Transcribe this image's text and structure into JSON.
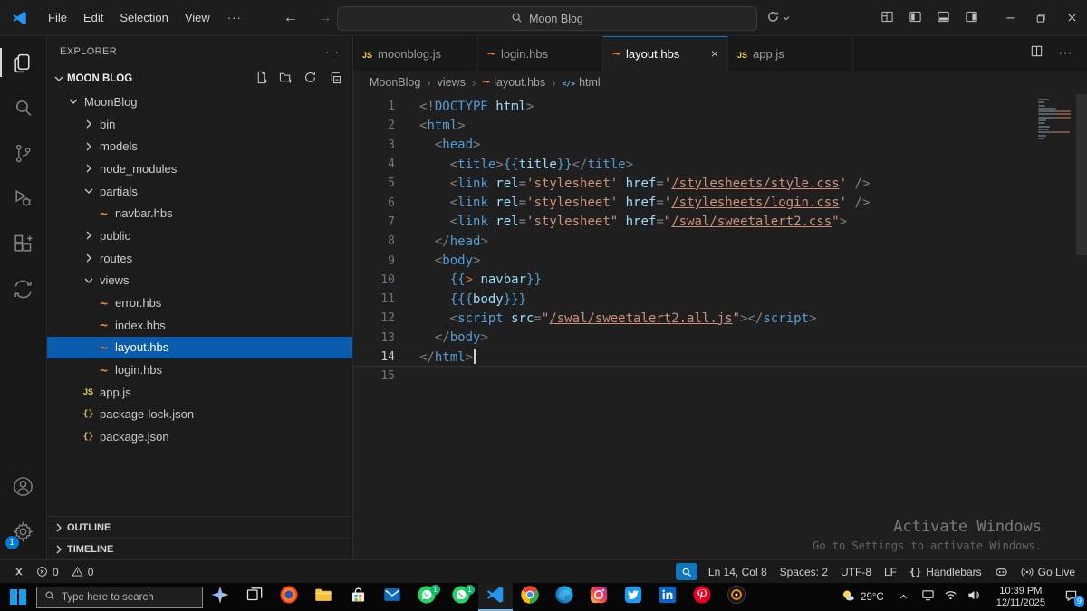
{
  "titlebar": {
    "menus": [
      "File",
      "Edit",
      "Selection",
      "View"
    ],
    "search_text": "Moon Blog",
    "layout_icons": [
      "layout-grid",
      "panel-left",
      "panel-bottom",
      "panel-right"
    ],
    "window_icons": [
      "minimize",
      "maximize",
      "close"
    ]
  },
  "activitybar": {
    "top_icons": [
      "explorer",
      "search",
      "source-control",
      "run-debug",
      "extensions",
      "remote-explorer"
    ],
    "active_icon": "explorer",
    "bottom_icons": [
      "account",
      "settings"
    ],
    "settings_badge": "1"
  },
  "sidebar": {
    "header": "EXPLORER",
    "section_label": "MOON BLOG",
    "action_icons": [
      "new-file",
      "new-folder",
      "refresh",
      "collapse-all"
    ],
    "tree": [
      {
        "label": "MoonBlog",
        "indent": 0,
        "icon": "chevron-down"
      },
      {
        "label": "bin",
        "indent": 1,
        "icon": "chevron-right"
      },
      {
        "label": "models",
        "indent": 1,
        "icon": "chevron-right"
      },
      {
        "label": "node_modules",
        "indent": 1,
        "icon": "chevron-right"
      },
      {
        "label": "partials",
        "indent": 1,
        "icon": "chevron-down"
      },
      {
        "label": "navbar.hbs",
        "indent": 2,
        "icon": "hbs"
      },
      {
        "label": "public",
        "indent": 1,
        "icon": "chevron-right"
      },
      {
        "label": "routes",
        "indent": 1,
        "icon": "chevron-right"
      },
      {
        "label": "views",
        "indent": 1,
        "icon": "chevron-down"
      },
      {
        "label": "error.hbs",
        "indent": 2,
        "icon": "hbs"
      },
      {
        "label": "index.hbs",
        "indent": 2,
        "icon": "hbs"
      },
      {
        "label": "layout.hbs",
        "indent": 2,
        "icon": "hbs",
        "selected": true
      },
      {
        "label": "login.hbs",
        "indent": 2,
        "icon": "hbs"
      },
      {
        "label": "app.js",
        "indent": 1,
        "icon": "js"
      },
      {
        "label": "package-lock.json",
        "indent": 1,
        "icon": "json"
      },
      {
        "label": "package.json",
        "indent": 1,
        "icon": "json"
      }
    ],
    "outline_label": "OUTLINE",
    "timeline_label": "TIMELINE"
  },
  "editor": {
    "tabs": [
      {
        "icon": "js",
        "label": "moonblog.js"
      },
      {
        "icon": "hbs",
        "label": "login.hbs"
      },
      {
        "icon": "hbs",
        "label": "layout.hbs",
        "active": true
      },
      {
        "icon": "js",
        "label": "app.js"
      }
    ],
    "breadcrumb": [
      {
        "label": "MoonBlog"
      },
      {
        "label": "views"
      },
      {
        "label": "layout.hbs",
        "icon": "hbs"
      },
      {
        "label": "html",
        "icon": "symbol"
      }
    ],
    "lines": [
      {
        "n": 1,
        "tokens": [
          [
            "p",
            "<!"
          ],
          [
            "t",
            "DOCTYPE"
          ],
          [
            "a",
            " html"
          ],
          [
            "p",
            ">"
          ]
        ]
      },
      {
        "n": 2,
        "tokens": [
          [
            "p",
            "<"
          ],
          [
            "t",
            "html"
          ],
          [
            "p",
            ">"
          ]
        ]
      },
      {
        "n": 3,
        "tokens": [
          [
            "w",
            "  "
          ],
          [
            "p",
            "<"
          ],
          [
            "t",
            "head"
          ],
          [
            "p",
            ">"
          ]
        ]
      },
      {
        "n": 4,
        "tokens": [
          [
            "w",
            "    "
          ],
          [
            "p",
            "<"
          ],
          [
            "t",
            "title"
          ],
          [
            "p",
            ">"
          ],
          [
            "h",
            "{{"
          ],
          [
            "i",
            "title"
          ],
          [
            "h",
            "}}"
          ],
          [
            "p",
            "</"
          ],
          [
            "t",
            "title"
          ],
          [
            "p",
            ">"
          ]
        ]
      },
      {
        "n": 5,
        "tokens": [
          [
            "w",
            "    "
          ],
          [
            "p",
            "<"
          ],
          [
            "t",
            "link"
          ],
          [
            "a",
            " rel"
          ],
          [
            "p",
            "="
          ],
          [
            "s",
            "'stylesheet'"
          ],
          [
            "a",
            " href"
          ],
          [
            "p",
            "="
          ],
          [
            "s",
            "'"
          ],
          [
            "l",
            "/stylesheets/style.css"
          ],
          [
            "s",
            "'"
          ],
          [
            "w",
            " "
          ],
          [
            "p",
            "/>"
          ]
        ]
      },
      {
        "n": 6,
        "tokens": [
          [
            "w",
            "    "
          ],
          [
            "p",
            "<"
          ],
          [
            "t",
            "link"
          ],
          [
            "a",
            " rel"
          ],
          [
            "p",
            "="
          ],
          [
            "s",
            "'stylesheet'"
          ],
          [
            "a",
            " href"
          ],
          [
            "p",
            "="
          ],
          [
            "s",
            "'"
          ],
          [
            "l",
            "/stylesheets/login.css"
          ],
          [
            "s",
            "'"
          ],
          [
            "w",
            " "
          ],
          [
            "p",
            "/>"
          ]
        ]
      },
      {
        "n": 7,
        "tokens": [
          [
            "w",
            "    "
          ],
          [
            "p",
            "<"
          ],
          [
            "t",
            "link"
          ],
          [
            "a",
            " rel"
          ],
          [
            "p",
            "="
          ],
          [
            "s",
            "'stylesheet\""
          ],
          [
            "a",
            " href"
          ],
          [
            "p",
            "="
          ],
          [
            "s",
            "\""
          ],
          [
            "l",
            "/swal/sweetalert2.css"
          ],
          [
            "s",
            "\""
          ],
          [
            "p",
            ">"
          ]
        ]
      },
      {
        "n": 8,
        "tokens": [
          [
            "w",
            "  "
          ],
          [
            "p",
            "</"
          ],
          [
            "t",
            "head"
          ],
          [
            "p",
            ">"
          ]
        ]
      },
      {
        "n": 9,
        "tokens": [
          [
            "w",
            "  "
          ],
          [
            "p",
            "<"
          ],
          [
            "t",
            "body"
          ],
          [
            "p",
            ">"
          ]
        ]
      },
      {
        "n": 10,
        "tokens": [
          [
            "w",
            "    "
          ],
          [
            "h",
            "{{"
          ],
          [
            "g",
            ">"
          ],
          [
            "w",
            " "
          ],
          [
            "i",
            "navbar"
          ],
          [
            "h",
            "}}"
          ]
        ]
      },
      {
        "n": 11,
        "tokens": [
          [
            "w",
            "    "
          ],
          [
            "h",
            "{{{"
          ],
          [
            "i",
            "body"
          ],
          [
            "h",
            "}}}"
          ]
        ]
      },
      {
        "n": 12,
        "tokens": [
          [
            "w",
            "    "
          ],
          [
            "p",
            "<"
          ],
          [
            "t",
            "script"
          ],
          [
            "a",
            " src"
          ],
          [
            "p",
            "="
          ],
          [
            "s",
            "\""
          ],
          [
            "l",
            "/swal/sweetalert2.all.js"
          ],
          [
            "s",
            "\""
          ],
          [
            "p",
            "></"
          ],
          [
            "t",
            "script"
          ],
          [
            "p",
            ">"
          ]
        ]
      },
      {
        "n": 13,
        "tokens": [
          [
            "w",
            "  "
          ],
          [
            "p",
            "</"
          ],
          [
            "t",
            "body"
          ],
          [
            "p",
            ">"
          ]
        ]
      },
      {
        "n": 14,
        "tokens": [
          [
            "p",
            "</"
          ],
          [
            "t",
            "html"
          ],
          [
            "p",
            ">"
          ]
        ],
        "active": true,
        "cursor": true
      },
      {
        "n": 15,
        "tokens": []
      }
    ]
  },
  "statusbar": {
    "left": [
      {
        "icon": "remote",
        "name": "remote-indicator"
      },
      {
        "icon": "error",
        "label": "0",
        "name": "errors"
      },
      {
        "icon": "warning",
        "label": "0",
        "name": "warnings"
      }
    ],
    "right": [
      {
        "icon": "zoom",
        "name": "zoom-indicator",
        "highlight": true
      },
      {
        "label": "Ln 14, Col 8",
        "name": "cursor-position"
      },
      {
        "label": "Spaces: 2",
        "name": "indentation"
      },
      {
        "label": "UTF-8",
        "name": "encoding"
      },
      {
        "label": "LF",
        "name": "eol"
      },
      {
        "icon": "braces",
        "label": "Handlebars",
        "name": "language-mode"
      },
      {
        "icon": "copilot",
        "name": "copilot"
      },
      {
        "icon": "broadcast",
        "label": "Go Live",
        "name": "go-live"
      }
    ]
  },
  "watermark": {
    "title": "Activate Windows",
    "subtitle": "Go to Settings to activate Windows."
  },
  "taskbar": {
    "search_placeholder": "Type here to search",
    "apps": [
      {
        "name": "copilot-star"
      },
      {
        "name": "task-view"
      },
      {
        "name": "firefox"
      },
      {
        "name": "file-explorer"
      },
      {
        "name": "store"
      },
      {
        "name": "mail"
      },
      {
        "name": "whatsapp",
        "badge": "1"
      },
      {
        "name": "whatsapp-business",
        "badge": "1"
      },
      {
        "name": "vscode",
        "active": true
      },
      {
        "name": "chrome"
      },
      {
        "name": "edge"
      },
      {
        "name": "instagram"
      },
      {
        "name": "twitter"
      },
      {
        "name": "linkedin"
      },
      {
        "name": "pinterest"
      },
      {
        "name": "media-player"
      }
    ],
    "weather_temp": "29°C",
    "tray_icons": [
      "pc",
      "wifi",
      "volume"
    ],
    "clock_time": "10:39 PM",
    "clock_date": "12/11/2025",
    "notification_count": "9"
  }
}
